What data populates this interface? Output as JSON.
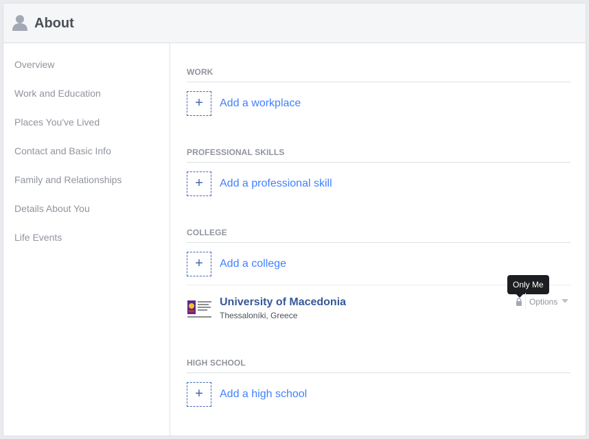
{
  "header": {
    "title": "About",
    "icon": "person-icon"
  },
  "sidebar": {
    "items": [
      {
        "label": "Overview"
      },
      {
        "label": "Work and Education"
      },
      {
        "label": "Places You've Lived"
      },
      {
        "label": "Contact and Basic Info"
      },
      {
        "label": "Family and Relationships"
      },
      {
        "label": "Details About You"
      },
      {
        "label": "Life Events"
      }
    ]
  },
  "sections": {
    "work": {
      "heading": "WORK",
      "add_label": "Add a workplace"
    },
    "skills": {
      "heading": "PROFESSIONAL SKILLS",
      "add_label": "Add a professional skill"
    },
    "college": {
      "heading": "COLLEGE",
      "add_label": "Add a college",
      "entry": {
        "name": "University of Macedonia",
        "location": "Thessaloníki, Greece",
        "privacy_tooltip": "Only Me",
        "options_label": "Options"
      }
    },
    "high_school": {
      "heading": "HIGH SCHOOL",
      "add_label": "Add a high school"
    }
  },
  "add_symbol": "+",
  "colors": {
    "link": "#365899",
    "accent": "#4267b2",
    "muted": "#90949c"
  }
}
